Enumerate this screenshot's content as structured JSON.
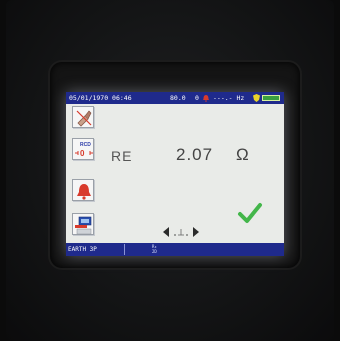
{
  "status": {
    "date_time": "05/01/1970 06:46",
    "voltage": "80.0",
    "zero": "0",
    "frequency": "---.- Hz"
  },
  "icons": {
    "probe": "probe-icon",
    "rdd": "rdd-zero-icon",
    "alarm": "bell-icon",
    "settings": "settings-icon",
    "ok": "checkmark-icon",
    "nav": "left-right-arrows-icon",
    "battery": "battery-icon",
    "shield": "shield-icon"
  },
  "sidebar": {
    "rdd_label": "RCD"
  },
  "measurement": {
    "label": "RE",
    "value": "2.07",
    "unit": "Ω"
  },
  "bottom": {
    "mode": "EARTH 3P",
    "mini_top": "R₀",
    "mini_bottom": "2D"
  },
  "colors": {
    "bar": "#1f2a8c",
    "screen": "#e9ebe8",
    "alarm": "#d83a2c",
    "ok": "#43b64a"
  }
}
